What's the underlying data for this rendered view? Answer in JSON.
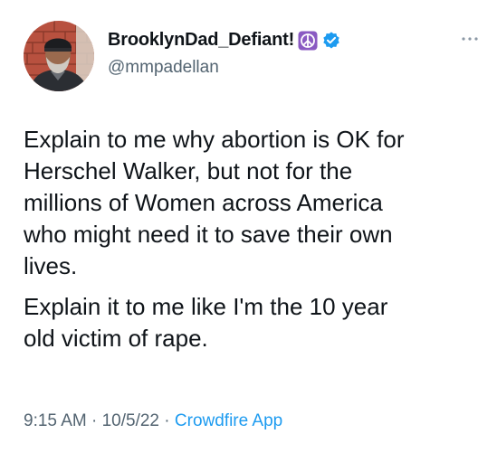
{
  "user": {
    "display_name": "BrooklynDad_Defiant!",
    "handle": "@mmpadellan"
  },
  "icons": {
    "peace": "peace-symbol-icon",
    "verified": "verified-badge-icon",
    "more": "more-options-icon"
  },
  "tweet": {
    "paragraphs": [
      "Explain to me why abortion is OK for\nHerschel Walker, but not for the\nmillions of Women across America\nwho might need it to save their own\nlives.",
      "Explain it to me like I'm the 10 year\nold victim of rape."
    ]
  },
  "meta": {
    "time": "9:15 AM",
    "separator": " · ",
    "date": "10/5/22",
    "source": "Crowdfire App"
  },
  "colors": {
    "text": "#0f1419",
    "muted": "#536471",
    "link": "#1d9bf0",
    "verified": "#1d9bf0",
    "peace_bg": "#8a5ac2"
  }
}
